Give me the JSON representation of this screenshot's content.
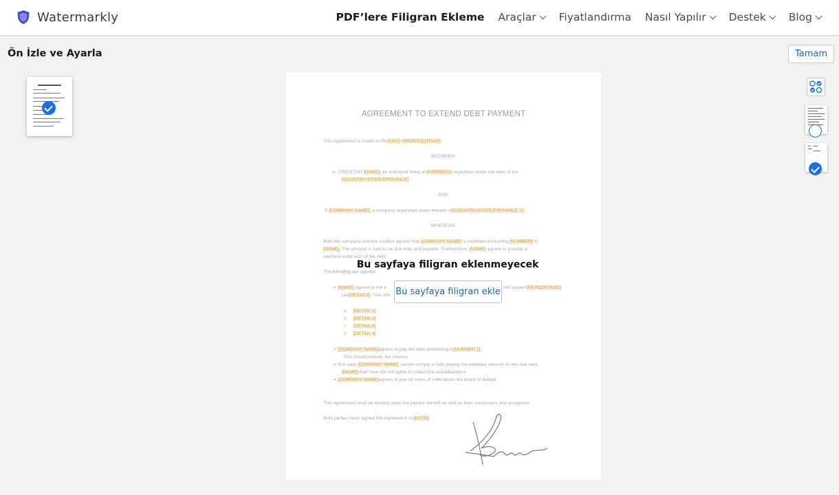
{
  "app": {
    "name": "Watermarkly",
    "brand_color": "#4f46c8"
  },
  "nav": {
    "items": [
      {
        "label": "PDF’lere Filigran Ekleme",
        "active": true,
        "dropdown": false
      },
      {
        "label": "Araçlar",
        "dropdown": true
      },
      {
        "label": "Fiyatlandırma",
        "dropdown": false
      },
      {
        "label": "Nasıl Yapılır",
        "dropdown": true
      },
      {
        "label": "Destek",
        "dropdown": true
      },
      {
        "label": "Blog",
        "dropdown": true
      }
    ]
  },
  "page": {
    "title": "Ön İzle ve Ayarla",
    "done_label": "Tamam"
  },
  "overlay": {
    "message": "Bu sayfaya filigran eklenmeyecek",
    "add_button_label": "Bu sayfaya filigran ekle"
  },
  "document": {
    "title": "AGREEMENT TO EXTEND DEBT PAYMENT",
    "intro_pre": "This Agreement is made on the",
    "day": "[DAY]",
    "of": "of",
    "month_year": "[MONTH],[YEAR].",
    "between": "BETWEEN:",
    "creditor_prefix": "A.   CREDITOR",
    "creditor_name": "[NAME],",
    "creditor_mid": "an individual       living at",
    "creditor_address": "[ADDRESS]",
    "creditor_end": "organized under     the   laws of    the",
    "creditor_country": "[COUNTRY/STATE/PROVINCE]",
    "creditor_dot": ".",
    "and": "AND:",
    "b_prefix": "B.",
    "company_name": "[COMPANY NAME],",
    "b_mid": "a company organized under thelaws of",
    "b_country": "[COUNTRY/STATE/PROVINCE 1].",
    "whereas": "WHEREAS:",
    "w1_a": "Both the company and the creditor agreed that",
    "w1_company": "[COMPANY NAME]",
    "w1_b": "is indebted amounting",
    "w1_number": "[NUMBER]",
    "w1_c": "to",
    "w2_name": "[NAME]",
    "w2_a": ". The amount is said to be due now and payable. Furthermore,",
    "w2_name2": "[NAME]",
    "w2_b": "agrees to provide a",
    "w3": "payment extension of the debt.",
    "agreed": "The following are agreed:",
    "b1_name": "[NAME]",
    "b1_a": "agrees to the e",
    "b1_b": "still unpaid",
    "b1_percentage": "[PERCENTAGE]",
    "b1_per": "per",
    "b1_details": "[DETAILS]",
    "b1_c": ". This sho",
    "details": [
      {
        "marker": "a.",
        "label": "[DETAIL 1]"
      },
      {
        "marker": "b.",
        "label": "[DETAIL 2]"
      },
      {
        "marker": "c.",
        "label": "[DETAIL 3]"
      },
      {
        "marker": "d.",
        "label": "[DETAIL 4]"
      }
    ],
    "b2_company": "[COMPANY NAME]",
    "b2_a": "agrees to pay the debt amounting to",
    "b2_number": "[NUMBER 1].",
    "b2_b": "This should include the interest.",
    "b3_a": "If in case",
    "b3_company": "[COMPANY NAME]",
    "b3_b": "cannot comply in fully paying the indebted amount on the due date,",
    "b3_name": "[NAME]",
    "b3_c": "shall have the full rights to collect the overallbalance.",
    "b4_company": "[COMPANY NAME]",
    "b4_a": "agrees to pay all sums of collectionin the event of default.",
    "binding": "This Agreement shall be binding upon the parties' benefit as well as their successors and assignees.",
    "signed_a": "Both parties have signed this Agreement on",
    "signed_date": "[DATE]."
  },
  "pages": {
    "page1_selected": true,
    "page2_selected": true,
    "right_page1_selected": false,
    "right_page2_selected": true,
    "accent_color": "#1e6ee8"
  }
}
